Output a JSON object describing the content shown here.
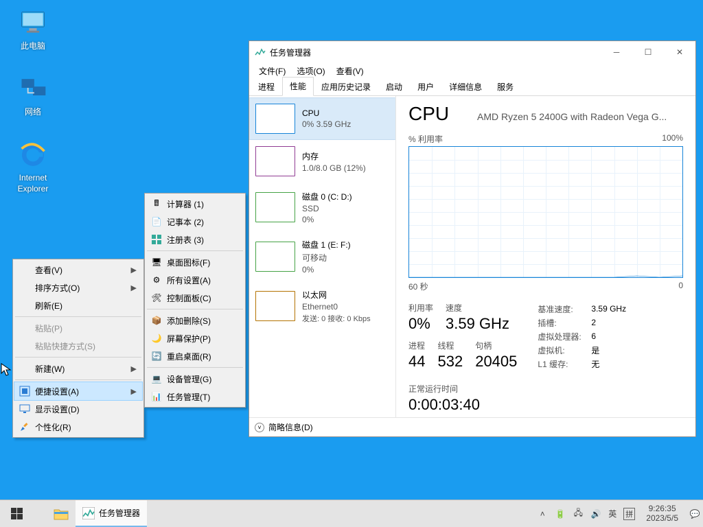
{
  "desktop_icons": {
    "pc": "此电脑",
    "network": "网络",
    "ie": "Internet\nExplorer"
  },
  "ctx1": {
    "view": "查看(V)",
    "sort": "排序方式(O)",
    "refresh": "刷新(E)",
    "paste": "粘贴(P)",
    "paste_shortcut": "粘贴快捷方式(S)",
    "new": "新建(W)",
    "quickset": "便捷设置(A)",
    "display": "显示设置(D)",
    "personalize": "个性化(R)"
  },
  "ctx2": {
    "calc": "计算器  (1)",
    "notepad": "记事本  (2)",
    "regedit": "注册表  (3)",
    "deskicon": "桌面图标(F)",
    "allsettings": "所有设置(A)",
    "cpl": "控制面板(C)",
    "addremove": "添加删除(S)",
    "screensaver": "屏幕保护(P)",
    "restart_desktop": "重启桌面(R)",
    "devmgr": "设备管理(G)",
    "taskmgr": "任务管理(T)"
  },
  "tm": {
    "title": "任务管理器",
    "menus": {
      "file": "文件(F)",
      "options": "选项(O)",
      "view": "查看(V)"
    },
    "tabs": {
      "proc": "进程",
      "perf": "性能",
      "hist": "应用历史记录",
      "startup": "启动",
      "users": "用户",
      "details": "详细信息",
      "services": "服务"
    },
    "side": {
      "cpu": {
        "name": "CPU",
        "sub": "0% 3.59 GHz"
      },
      "mem": {
        "name": "内存",
        "sub": "1.0/8.0 GB (12%)"
      },
      "disk0": {
        "name": "磁盘 0 (C: D:)",
        "sub1": "SSD",
        "sub2": "0%"
      },
      "disk1": {
        "name": "磁盘 1 (E: F:)",
        "sub1": "可移动",
        "sub2": "0%"
      },
      "eth": {
        "name": "以太网",
        "sub1": "Ethernet0",
        "sub2": "发送: 0 接收: 0 Kbps"
      }
    },
    "main": {
      "h1": "CPU",
      "model": "AMD Ryzen 5 2400G with Radeon Vega G...",
      "util_label": "% 利用率",
      "util_max": "100%",
      "axis_left": "60 秒",
      "axis_right": "0",
      "stats": {
        "util_k": "利用率",
        "util_v": "0%",
        "speed_k": "速度",
        "speed_v": "3.59 GHz",
        "proc_k": "进程",
        "proc_v": "44",
        "thread_k": "线程",
        "thread_v": "532",
        "handle_k": "句柄",
        "handle_v": "20405",
        "base_k": "基准速度:",
        "base_v": "3.59 GHz",
        "sock_k": "插槽:",
        "sock_v": "2",
        "vcpu_k": "虚拟处理器:",
        "vcpu_v": "6",
        "vm_k": "虚拟机:",
        "vm_v": "是",
        "l1_k": "L1 缓存:",
        "l1_v": "无"
      },
      "uptime_k": "正常运行时间",
      "uptime_v": "0:00:03:40"
    },
    "statusbar": "简略信息(D)"
  },
  "taskbar": {
    "app": "任务管理器",
    "ime1": "英",
    "ime2": "拼",
    "time": "9:26:35",
    "date": "2023/5/5"
  },
  "chart_data": {
    "type": "line",
    "title": "% 利用率",
    "xlabel": "60 秒",
    "ylabel": "",
    "ylim": [
      0,
      100
    ],
    "x": [
      60,
      55,
      50,
      45,
      40,
      35,
      30,
      25,
      20,
      15,
      10,
      5,
      0
    ],
    "series": [
      {
        "name": "CPU 利用率 %",
        "values": [
          0,
          0,
          0,
          0,
          0,
          0,
          0,
          0,
          0,
          0,
          1,
          0,
          1
        ]
      }
    ]
  }
}
